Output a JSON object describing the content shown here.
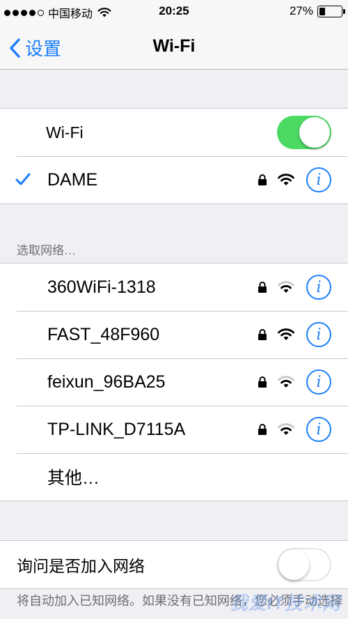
{
  "status_bar": {
    "carrier": "中国移动",
    "time": "20:25",
    "battery": "27%",
    "battery_level": 0.27,
    "signal_filled": 4,
    "signal_total": 5
  },
  "nav": {
    "back_label": "设置",
    "title": "Wi-Fi"
  },
  "wifi_toggle": {
    "label": "Wi-Fi",
    "on": true
  },
  "connected_network": {
    "name": "DAME",
    "locked": true,
    "signal": "full"
  },
  "choose_network_header": "选取网络…",
  "networks": [
    {
      "name": "360WiFi-1318",
      "locked": true,
      "signal": "medium"
    },
    {
      "name": "FAST_48F960",
      "locked": true,
      "signal": "full"
    },
    {
      "name": "feixun_96BA25",
      "locked": true,
      "signal": "medium"
    },
    {
      "name": "TP-LINK_D7115A",
      "locked": true,
      "signal": "medium"
    }
  ],
  "other_label": "其他…",
  "ask_to_join": {
    "label": "询问是否加入网络",
    "on": false
  },
  "footer_text": "将自动加入已知网络。如果没有已知网络，您必须手动选择",
  "watermark": "我爱IT技术网",
  "colors": {
    "accent": "#1a7efb",
    "toggle_on": "#4cd964",
    "background": "#efeff4"
  }
}
